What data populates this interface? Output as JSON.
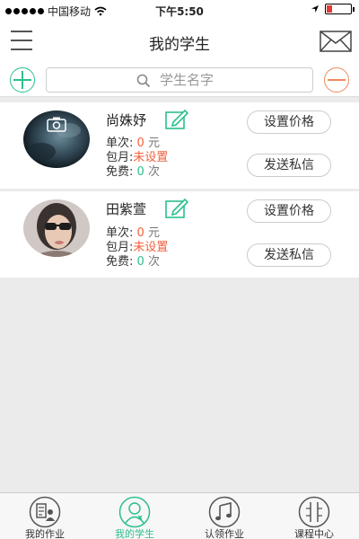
{
  "status_bar": {
    "carrier": "中国移动",
    "time": "下午5:50"
  },
  "header": {
    "title": "我的学生"
  },
  "search": {
    "placeholder": "学生名字"
  },
  "labels": {
    "single": "单次:",
    "monthly": "包月:",
    "free": "免费:"
  },
  "students": [
    {
      "name": "尚姝妤",
      "single_value": "0",
      "single_unit": "元",
      "monthly_value": "未设置",
      "free_value": "0",
      "free_unit": "次",
      "set_price_label": "设置价格",
      "message_label": "发送私信"
    },
    {
      "name": "田紫萱",
      "single_value": "0",
      "single_unit": "元",
      "monthly_value": "未设置",
      "free_value": "0",
      "free_unit": "次",
      "set_price_label": "设置价格",
      "message_label": "发送私信"
    }
  ],
  "tabs": [
    {
      "label": "我的作业",
      "icon": "homework-icon",
      "active": false
    },
    {
      "label": "我的学生",
      "icon": "student-icon",
      "active": true
    },
    {
      "label": "认领作业",
      "icon": "music-note-icon",
      "active": false
    },
    {
      "label": "课程中心",
      "icon": "course-icon",
      "active": false
    }
  ],
  "colors": {
    "accent_green": "#2bbf8e",
    "accent_orange": "#f0623c"
  }
}
